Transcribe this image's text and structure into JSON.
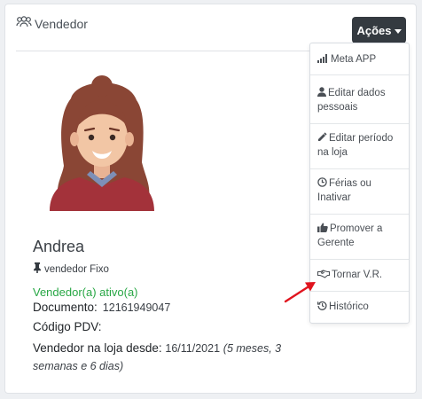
{
  "card": {
    "title": "Vendedor"
  },
  "actions_button": {
    "label": "Ações"
  },
  "menu": {
    "items": [
      {
        "label": "Meta APP",
        "icon": "signal-bars-icon"
      },
      {
        "label": "Editar dados pessoais",
        "icon": "user-icon"
      },
      {
        "label": "Editar período na loja",
        "icon": "pencil-icon"
      },
      {
        "label": "Férias ou Inativar",
        "icon": "clock-icon"
      },
      {
        "label": "Promover a Gerente",
        "icon": "thumbs-up-icon"
      },
      {
        "label": "Tornar V.R.",
        "icon": "handshake-icon"
      },
      {
        "label": "Histórico",
        "icon": "history-icon"
      }
    ]
  },
  "profile": {
    "name": "Andrea",
    "role": "vendedor Fixo",
    "status": "Vendedor(a) ativo(a)",
    "document_label": "Documento:",
    "document_value": "12161949047",
    "pdv_label": "Código PDV:",
    "pdv_value": "",
    "since_label": "Vendedor na loja desde:",
    "since_date": "16/11/2021",
    "since_duration": "(5 meses, 3 semanas e 6 dias)"
  },
  "colors": {
    "accent_dark": "#343a40",
    "status_green": "#28a745",
    "arrow_red": "#e0141e"
  }
}
